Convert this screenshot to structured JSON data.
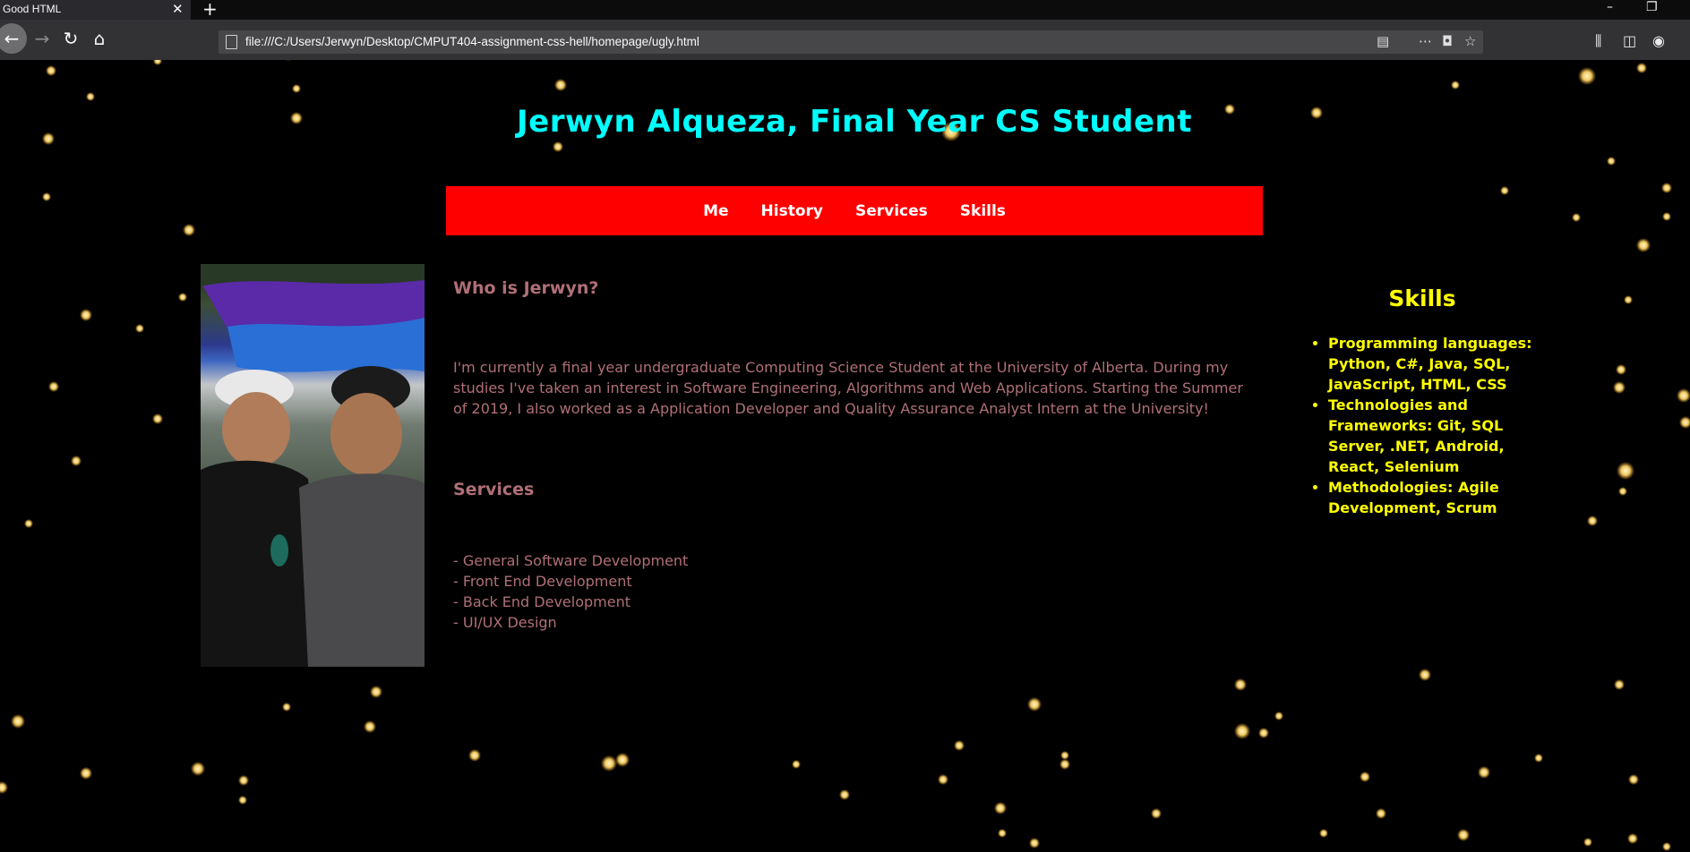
{
  "browser": {
    "tab_title": "Good HTML",
    "url": "file:///C:/Users/Jerwyn/Desktop/CMPUT404-assignment-css-hell/homepage/ugly.html"
  },
  "page": {
    "headline": "Jerwyn Alqueza, Final Year CS Student",
    "nav": [
      "Me",
      "History",
      "Services",
      "Skills"
    ],
    "about_title": "Who is Jerwyn?",
    "about_text": "I'm currently a final year undergraduate Computing Science Student at the University of Alberta. During my studies I've taken an interest in Software Engineering, Algorithms and Web Applications. Starting the Summer of 2019, I also worked as a Application Developer and Quality Assurance Analyst Intern at the University!",
    "services_title": "Services",
    "services": [
      "- General Software Development",
      "- Front End Development",
      "- Back End Development",
      "- UI/UX Design"
    ],
    "skills_title": "Skills",
    "skills": [
      "Programming languages: Python, C#, Java, SQL, JavaScript, HTML, CSS",
      "Technologies and Frameworks: Git, SQL Server, .NET, Android, React, Selenium",
      "Methodologies: Agile Development, Scrum"
    ]
  },
  "colors": {
    "headline": "#00ffff",
    "menu_bg": "#ff0000",
    "body_text": "#b06f78",
    "sidebar_text": "#ffff00"
  }
}
